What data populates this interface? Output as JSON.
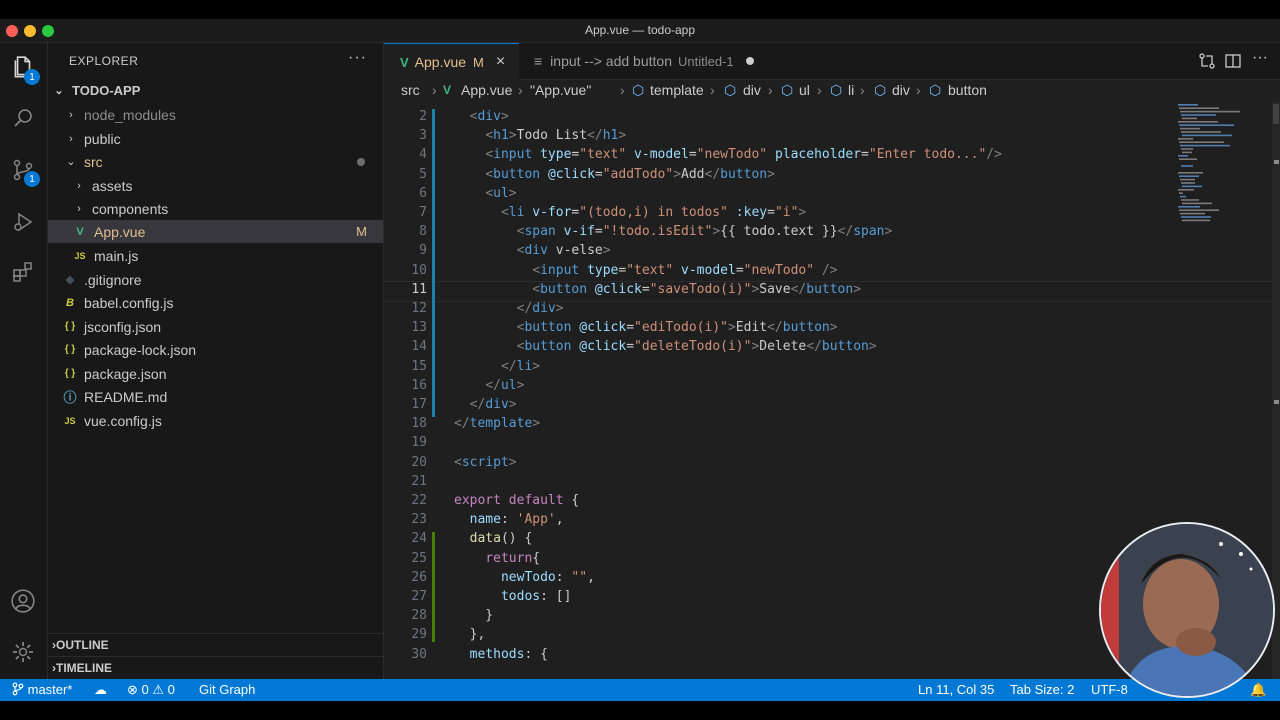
{
  "window": {
    "title": "App.vue — todo-app"
  },
  "activity_bar": {
    "explorer_badge": "1",
    "scm_badge": "1"
  },
  "explorer": {
    "header": "EXPLORER",
    "more": "···",
    "folder": "TODO-APP",
    "items": [
      {
        "label": "node_modules"
      },
      {
        "label": "public"
      },
      {
        "label": "src"
      },
      {
        "label": "assets"
      },
      {
        "label": "components"
      },
      {
        "label": "App.vue",
        "status": "M"
      },
      {
        "label": "main.js"
      },
      {
        "label": ".gitignore"
      },
      {
        "label": "babel.config.js"
      },
      {
        "label": "jsconfig.json"
      },
      {
        "label": "package-lock.json"
      },
      {
        "label": "package.json"
      },
      {
        "label": "README.md"
      },
      {
        "label": "vue.config.js"
      }
    ],
    "icons": {
      "js": "JS",
      "json": "{ }",
      "info": "ⓘ"
    },
    "outline": "OUTLINE",
    "timeline": "TIMELINE"
  },
  "tabs": [
    {
      "label": "App.vue",
      "status": "M"
    },
    {
      "label": "input --> add button",
      "detail": "Untitled-1"
    }
  ],
  "breadcrumbs": [
    "src",
    "App.vue",
    "\"App.vue\"",
    "template",
    "div",
    "ul",
    "li",
    "div",
    "button"
  ],
  "editor": {
    "lines": [
      {
        "n": "2",
        "text": "  <div>"
      },
      {
        "n": "3",
        "text": "    <h1>Todo List</h1>"
      },
      {
        "n": "4",
        "text": "    <input type=\"text\" v-model=\"newTodo\" placeholder=\"Enter todo...\"/>"
      },
      {
        "n": "5",
        "text": "    <button @click=\"addTodo\">Add</button>"
      },
      {
        "n": "6",
        "text": "    <ul>"
      },
      {
        "n": "7",
        "text": "      <li v-for=\"(todo,i) in todos\" :key=\"i\">"
      },
      {
        "n": "8",
        "text": "        <span v-if=\"!todo.isEdit\">{{ todo.text }}</span>"
      },
      {
        "n": "9",
        "text": "        <div v-else>"
      },
      {
        "n": "10",
        "text": "          <input type=\"text\" v-model=\"newTodo\" />"
      },
      {
        "n": "11",
        "text": "          <button @click=\"saveTodo(i)\">Save</button>"
      },
      {
        "n": "12",
        "text": "        </div>"
      },
      {
        "n": "13",
        "text": "        <button @click=\"ediTodo(i)\">Edit</button>"
      },
      {
        "n": "14",
        "text": "        <button @click=\"deleteTodo(i)\">Delete</button>"
      },
      {
        "n": "15",
        "text": "      </li>"
      },
      {
        "n": "16",
        "text": "    </ul>"
      },
      {
        "n": "17",
        "text": "  </div>"
      },
      {
        "n": "18",
        "text": "</template>"
      },
      {
        "n": "19",
        "text": ""
      },
      {
        "n": "20",
        "text": "<script>"
      },
      {
        "n": "21",
        "text": ""
      },
      {
        "n": "22",
        "text": "export default {"
      },
      {
        "n": "23",
        "text": "  name: 'App',"
      },
      {
        "n": "24",
        "text": "  data() {"
      },
      {
        "n": "25",
        "text": "    return{"
      },
      {
        "n": "26",
        "text": "      newTodo: \"\","
      },
      {
        "n": "27",
        "text": "      todos: []"
      },
      {
        "n": "28",
        "text": "    }"
      },
      {
        "n": "29",
        "text": "  },"
      },
      {
        "n": "30",
        "text": "  methods: {"
      }
    ],
    "current_line": "11"
  },
  "status_bar": {
    "branch": "master*",
    "errors": "0",
    "warnings": "0",
    "git_graph": "Git Graph",
    "position": "Ln 11, Col 35",
    "tab_size": "Tab Size: 2",
    "encoding": "UTF-8"
  },
  "colors": {
    "accent": "#0078d4",
    "modified": "#e2c08d",
    "vue_green": "#41b883"
  }
}
